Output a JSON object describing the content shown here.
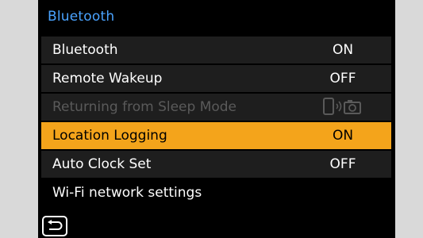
{
  "menu": {
    "title": "Bluetooth",
    "items": [
      {
        "label": "Bluetooth",
        "value": "ON"
      },
      {
        "label": "Remote Wakeup",
        "value": "OFF"
      },
      {
        "label": "Returning from Sleep Mode",
        "value_icon": "phone-camera-wireless-icon",
        "state": "disabled"
      },
      {
        "label": "Location Logging",
        "value": "ON",
        "state": "selected"
      },
      {
        "label": "Auto Clock Set",
        "value": "OFF"
      },
      {
        "label": "Wi-Fi network settings"
      }
    ]
  },
  "back_button": {
    "icon": "return-arrow-icon"
  },
  "colors": {
    "title": "#4aa3ff",
    "selected_background": "#f4a41b",
    "row_background": "#1e1e1e",
    "disabled_text": "#5a5a5a"
  }
}
